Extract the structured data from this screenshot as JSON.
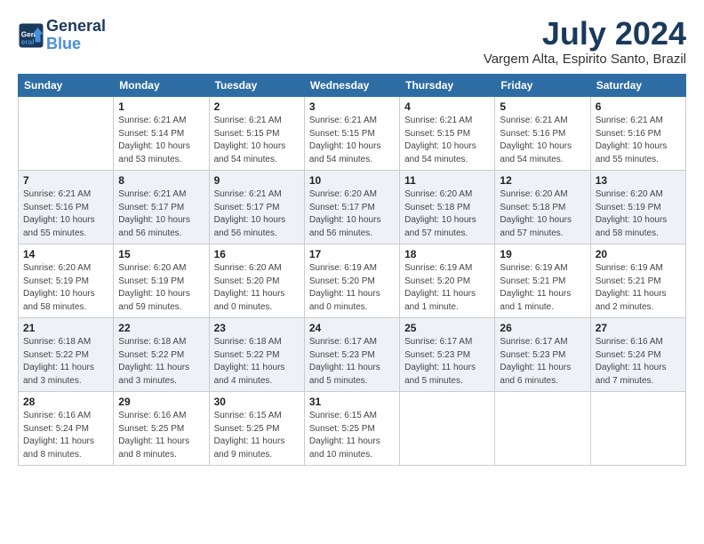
{
  "header": {
    "logo_line1": "General",
    "logo_line2": "Blue",
    "month_year": "July 2024",
    "location": "Vargem Alta, Espirito Santo, Brazil"
  },
  "days_of_week": [
    "Sunday",
    "Monday",
    "Tuesday",
    "Wednesday",
    "Thursday",
    "Friday",
    "Saturday"
  ],
  "weeks": [
    [
      {
        "day": "",
        "info": ""
      },
      {
        "day": "1",
        "info": "Sunrise: 6:21 AM\nSunset: 5:14 PM\nDaylight: 10 hours\nand 53 minutes."
      },
      {
        "day": "2",
        "info": "Sunrise: 6:21 AM\nSunset: 5:15 PM\nDaylight: 10 hours\nand 54 minutes."
      },
      {
        "day": "3",
        "info": "Sunrise: 6:21 AM\nSunset: 5:15 PM\nDaylight: 10 hours\nand 54 minutes."
      },
      {
        "day": "4",
        "info": "Sunrise: 6:21 AM\nSunset: 5:15 PM\nDaylight: 10 hours\nand 54 minutes."
      },
      {
        "day": "5",
        "info": "Sunrise: 6:21 AM\nSunset: 5:16 PM\nDaylight: 10 hours\nand 54 minutes."
      },
      {
        "day": "6",
        "info": "Sunrise: 6:21 AM\nSunset: 5:16 PM\nDaylight: 10 hours\nand 55 minutes."
      }
    ],
    [
      {
        "day": "7",
        "info": "Sunrise: 6:21 AM\nSunset: 5:16 PM\nDaylight: 10 hours\nand 55 minutes."
      },
      {
        "day": "8",
        "info": "Sunrise: 6:21 AM\nSunset: 5:17 PM\nDaylight: 10 hours\nand 56 minutes."
      },
      {
        "day": "9",
        "info": "Sunrise: 6:21 AM\nSunset: 5:17 PM\nDaylight: 10 hours\nand 56 minutes."
      },
      {
        "day": "10",
        "info": "Sunrise: 6:20 AM\nSunset: 5:17 PM\nDaylight: 10 hours\nand 56 minutes."
      },
      {
        "day": "11",
        "info": "Sunrise: 6:20 AM\nSunset: 5:18 PM\nDaylight: 10 hours\nand 57 minutes."
      },
      {
        "day": "12",
        "info": "Sunrise: 6:20 AM\nSunset: 5:18 PM\nDaylight: 10 hours\nand 57 minutes."
      },
      {
        "day": "13",
        "info": "Sunrise: 6:20 AM\nSunset: 5:19 PM\nDaylight: 10 hours\nand 58 minutes."
      }
    ],
    [
      {
        "day": "14",
        "info": "Sunrise: 6:20 AM\nSunset: 5:19 PM\nDaylight: 10 hours\nand 58 minutes."
      },
      {
        "day": "15",
        "info": "Sunrise: 6:20 AM\nSunset: 5:19 PM\nDaylight: 10 hours\nand 59 minutes."
      },
      {
        "day": "16",
        "info": "Sunrise: 6:20 AM\nSunset: 5:20 PM\nDaylight: 11 hours\nand 0 minutes."
      },
      {
        "day": "17",
        "info": "Sunrise: 6:19 AM\nSunset: 5:20 PM\nDaylight: 11 hours\nand 0 minutes."
      },
      {
        "day": "18",
        "info": "Sunrise: 6:19 AM\nSunset: 5:20 PM\nDaylight: 11 hours\nand 1 minute."
      },
      {
        "day": "19",
        "info": "Sunrise: 6:19 AM\nSunset: 5:21 PM\nDaylight: 11 hours\nand 1 minute."
      },
      {
        "day": "20",
        "info": "Sunrise: 6:19 AM\nSunset: 5:21 PM\nDaylight: 11 hours\nand 2 minutes."
      }
    ],
    [
      {
        "day": "21",
        "info": "Sunrise: 6:18 AM\nSunset: 5:22 PM\nDaylight: 11 hours\nand 3 minutes."
      },
      {
        "day": "22",
        "info": "Sunrise: 6:18 AM\nSunset: 5:22 PM\nDaylight: 11 hours\nand 3 minutes."
      },
      {
        "day": "23",
        "info": "Sunrise: 6:18 AM\nSunset: 5:22 PM\nDaylight: 11 hours\nand 4 minutes."
      },
      {
        "day": "24",
        "info": "Sunrise: 6:17 AM\nSunset: 5:23 PM\nDaylight: 11 hours\nand 5 minutes."
      },
      {
        "day": "25",
        "info": "Sunrise: 6:17 AM\nSunset: 5:23 PM\nDaylight: 11 hours\nand 5 minutes."
      },
      {
        "day": "26",
        "info": "Sunrise: 6:17 AM\nSunset: 5:23 PM\nDaylight: 11 hours\nand 6 minutes."
      },
      {
        "day": "27",
        "info": "Sunrise: 6:16 AM\nSunset: 5:24 PM\nDaylight: 11 hours\nand 7 minutes."
      }
    ],
    [
      {
        "day": "28",
        "info": "Sunrise: 6:16 AM\nSunset: 5:24 PM\nDaylight: 11 hours\nand 8 minutes."
      },
      {
        "day": "29",
        "info": "Sunrise: 6:16 AM\nSunset: 5:25 PM\nDaylight: 11 hours\nand 8 minutes."
      },
      {
        "day": "30",
        "info": "Sunrise: 6:15 AM\nSunset: 5:25 PM\nDaylight: 11 hours\nand 9 minutes."
      },
      {
        "day": "31",
        "info": "Sunrise: 6:15 AM\nSunset: 5:25 PM\nDaylight: 11 hours\nand 10 minutes."
      },
      {
        "day": "",
        "info": ""
      },
      {
        "day": "",
        "info": ""
      },
      {
        "day": "",
        "info": ""
      }
    ]
  ]
}
